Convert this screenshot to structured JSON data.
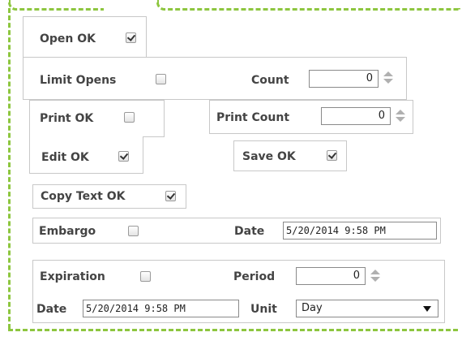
{
  "open_ok": {
    "label": "Open OK",
    "checked": true
  },
  "limit_opens": {
    "label": "Limit Opens",
    "checked": false
  },
  "count": {
    "label": "Count",
    "value": "0"
  },
  "print_ok": {
    "label": "Print OK",
    "checked": false
  },
  "print_count": {
    "label": "Print Count",
    "value": "0"
  },
  "edit_ok": {
    "label": "Edit OK",
    "checked": true
  },
  "save_ok": {
    "label": "Save OK",
    "checked": true
  },
  "copy_text_ok": {
    "label": "Copy Text OK",
    "checked": true
  },
  "embargo": {
    "label": "Embargo",
    "checked": false,
    "date_label": "Date",
    "date_value": "5/20/2014 9:58 PM"
  },
  "expiration": {
    "label": "Expiration",
    "checked": false,
    "period_label": "Period",
    "period_value": "0",
    "date_label": "Date",
    "date_value": "5/20/2014 9:58 PM",
    "unit_label": "Unit",
    "unit_value": "Day"
  },
  "colors": {
    "accent_dashed": "#8dc63f",
    "box_border": "#c8c8c8"
  }
}
